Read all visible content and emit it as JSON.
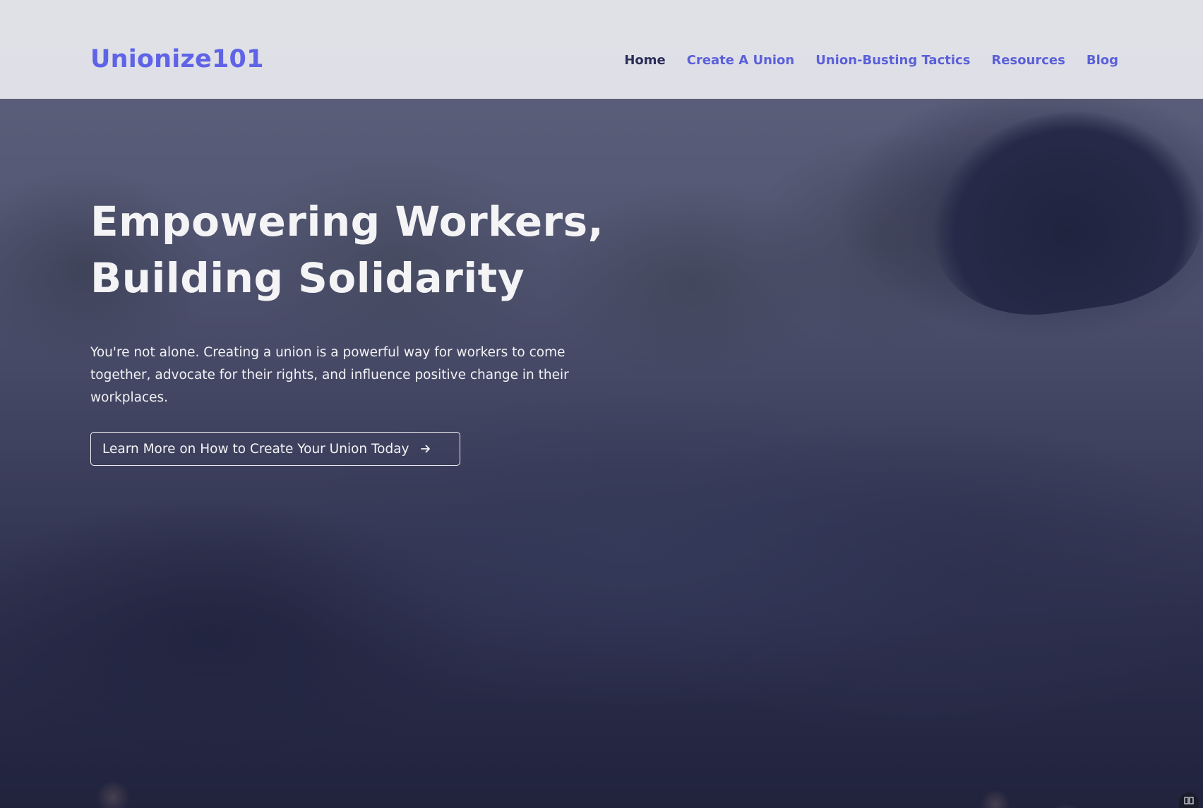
{
  "header": {
    "logo": "Unionize101",
    "nav": [
      {
        "label": "Home",
        "active": true
      },
      {
        "label": "Create A Union",
        "active": false
      },
      {
        "label": "Union-Busting Tactics",
        "active": false
      },
      {
        "label": "Resources",
        "active": false
      },
      {
        "label": "Blog",
        "active": false
      }
    ]
  },
  "hero": {
    "headline_line1": "Empowering Workers,",
    "headline_line2": "Building Solidarity",
    "intro": "You're not alone. Creating a union is a powerful way for workers to come together, advocate for their rights, and influence positive change in their workplaces.",
    "cta_label": "Learn More on How to Create Your Union Today",
    "cta_icon": "arrow-right-icon"
  },
  "colors": {
    "brand": "#5f63e6",
    "nav_active": "#2c2d58",
    "header_bg": "#e8e9ee",
    "hero_text": "#f4f4f6"
  }
}
